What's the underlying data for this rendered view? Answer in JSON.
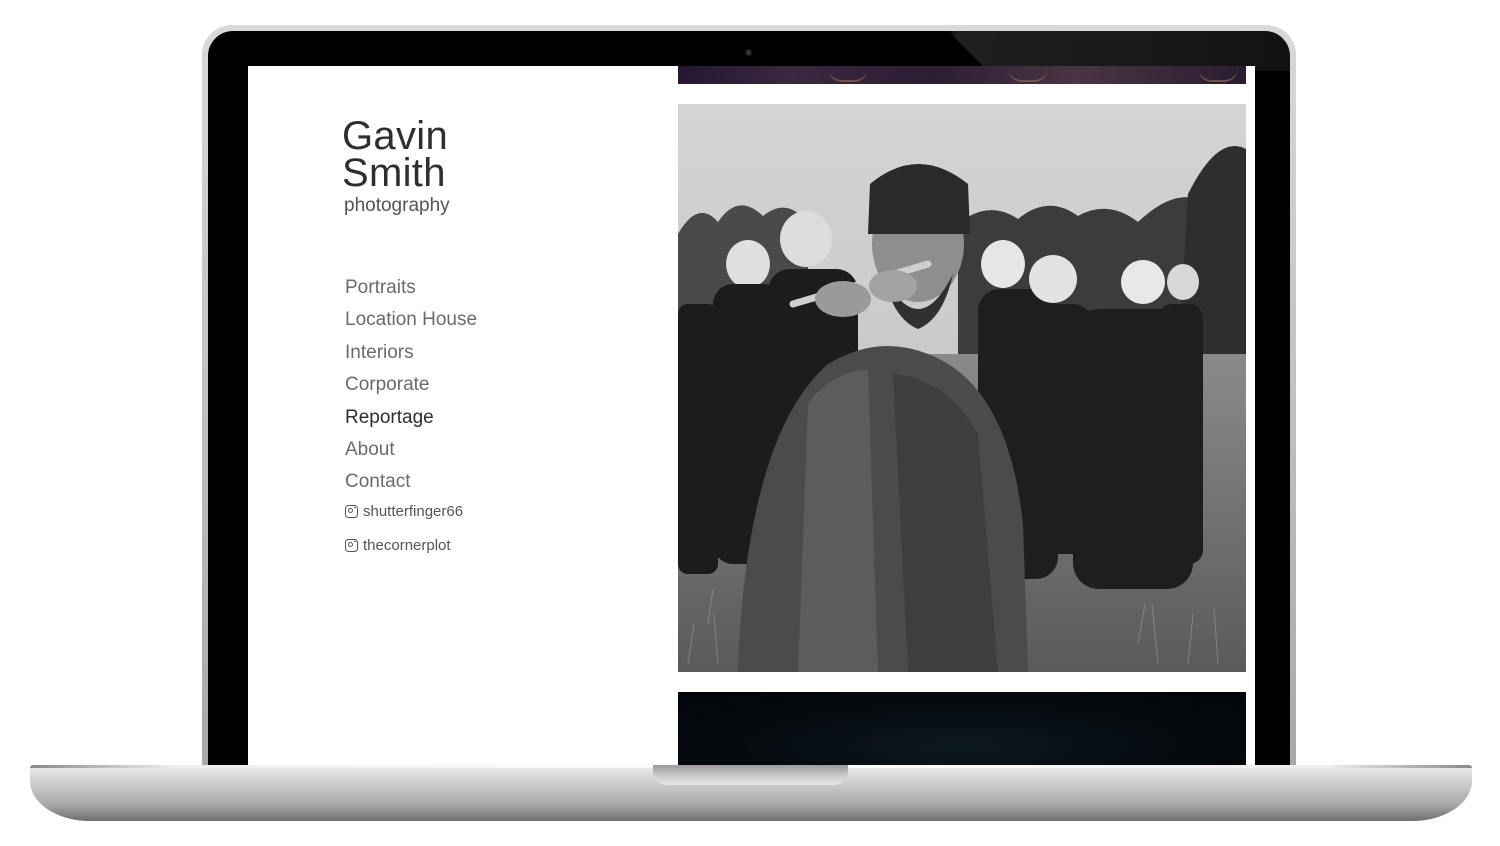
{
  "site": {
    "brand_line1": "Gavin",
    "brand_line2": "Smith",
    "brand_sub": "photography"
  },
  "nav": {
    "items": [
      {
        "label": "Portraits",
        "active": false
      },
      {
        "label": "Location House",
        "active": false
      },
      {
        "label": "Interiors",
        "active": false
      },
      {
        "label": "Corporate",
        "active": false
      },
      {
        "label": "Reportage",
        "active": true
      },
      {
        "label": "About",
        "active": false
      },
      {
        "label": "Contact",
        "active": false
      }
    ]
  },
  "social": [
    {
      "icon": "instagram-icon",
      "label": "shutterfinger66"
    },
    {
      "icon": "instagram-icon",
      "label": "thecornerplot"
    }
  ],
  "colors": {
    "nav_text": "#6b6b6b",
    "nav_active": "#2e2e2e",
    "brand_text": "#2f2f2f"
  }
}
